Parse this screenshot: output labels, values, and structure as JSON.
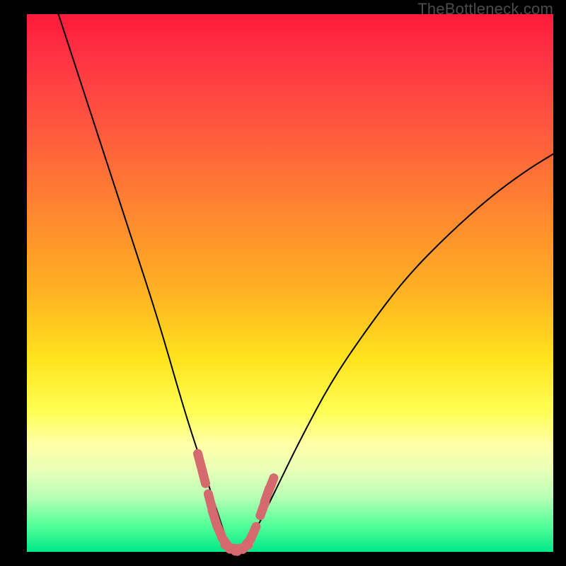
{
  "watermark": "TheBottleneck.com",
  "colors": {
    "bg_black": "#000000",
    "grad_top": "#ff1a3a",
    "grad_bottom": "#00e888",
    "curve_stroke": "#000000",
    "marker_fill": "#d46a6d"
  },
  "chart_data": {
    "type": "line",
    "title": "",
    "xlabel": "",
    "ylabel": "",
    "xlim": [
      0,
      100
    ],
    "ylim": [
      0,
      100
    ],
    "note": "x and y are read in percent of the plot area; y=0 at bottom (green), y=100 at top (red). Curve is a V/valley shape with minimum near x≈39.",
    "series": [
      {
        "name": "bottleneck-curve",
        "x": [
          6,
          10,
          15,
          20,
          25,
          30,
          33,
          35,
          37,
          38,
          39,
          40,
          41,
          42,
          44,
          46,
          48,
          52,
          58,
          65,
          72,
          80,
          88,
          95,
          100
        ],
        "y": [
          100,
          88,
          73,
          58,
          43,
          26,
          17,
          11,
          5,
          2,
          0.5,
          0.5,
          1,
          2,
          5,
          9,
          13,
          21,
          32,
          42,
          51,
          59,
          66,
          71,
          74
        ]
      }
    ],
    "markers": {
      "name": "highlight-points",
      "color": "#d46a6d",
      "points": [
        {
          "x": 32.8,
          "y": 17.0
        },
        {
          "x": 33.6,
          "y": 14.0
        },
        {
          "x": 34.8,
          "y": 9.5
        },
        {
          "x": 35.6,
          "y": 6.5
        },
        {
          "x": 36.6,
          "y": 3.8
        },
        {
          "x": 37.8,
          "y": 1.6
        },
        {
          "x": 38.8,
          "y": 0.7
        },
        {
          "x": 39.8,
          "y": 0.6
        },
        {
          "x": 40.8,
          "y": 0.7
        },
        {
          "x": 41.8,
          "y": 1.5
        },
        {
          "x": 43.0,
          "y": 3.5
        },
        {
          "x": 44.8,
          "y": 8.0
        },
        {
          "x": 45.6,
          "y": 10.5
        },
        {
          "x": 46.4,
          "y": 12.5
        }
      ]
    }
  }
}
